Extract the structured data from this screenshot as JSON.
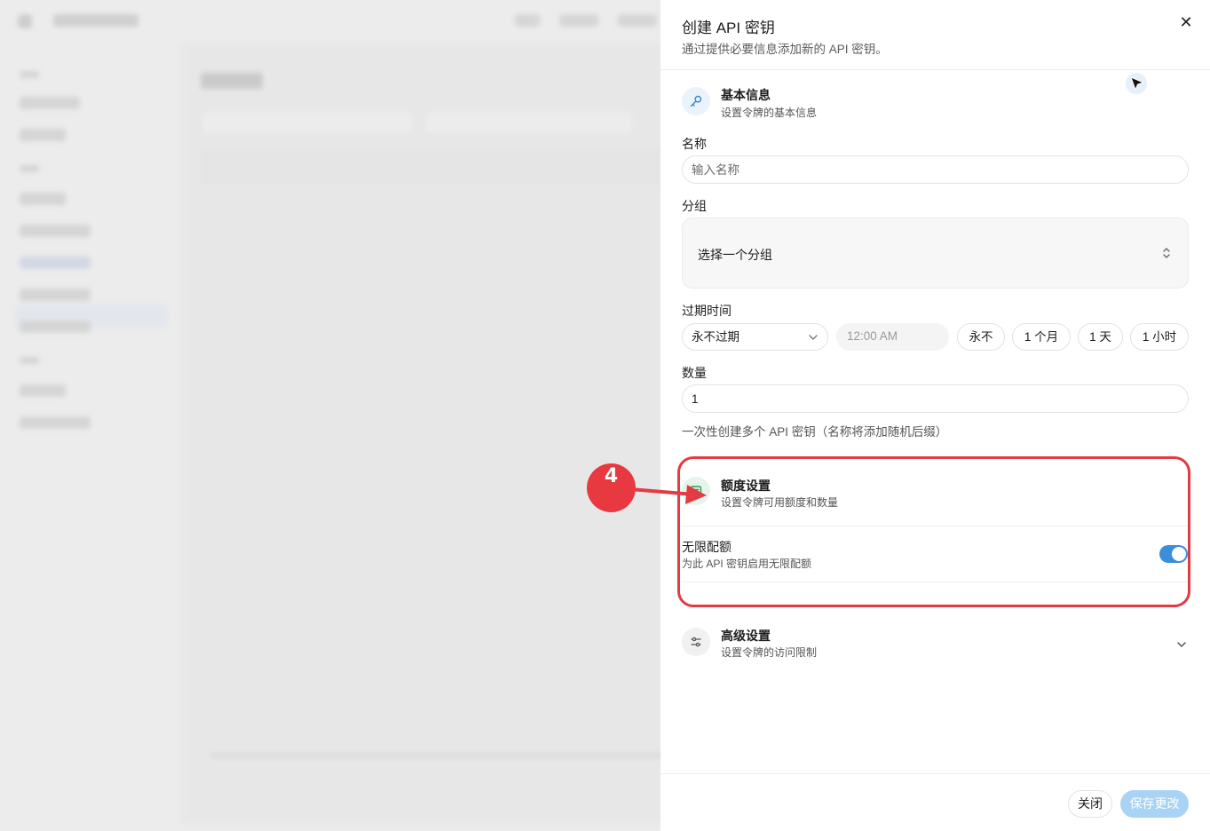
{
  "sheet": {
    "title": "创建 API 密钥",
    "description": "通过提供必要信息添加新的 API 密钥。",
    "close_icon": "close-icon"
  },
  "basic": {
    "title": "基本信息",
    "subtitle": "设置令牌的基本信息",
    "icon": "key-icon",
    "name_label": "名称",
    "name_placeholder": "输入名称",
    "group_label": "分组",
    "group_value": "选择一个分组",
    "group_icon": "chevron-up-down-icon",
    "expiry_label": "过期时间",
    "expiry_value": "永不过期",
    "expiry_time": "12:00 AM",
    "quick": [
      "永不",
      "1 个月",
      "1 天",
      "1 小时"
    ],
    "count_label": "数量",
    "count_value": "1",
    "count_help": "一次性创建多个 API 密钥（名称将添加随机后缀）"
  },
  "quota": {
    "title": "额度设置",
    "subtitle": "设置令牌可用额度和数量",
    "icon": "wallet-icon",
    "unlimited_label": "无限配额",
    "unlimited_desc": "为此 API 密钥启用无限配额",
    "unlimited_on": true
  },
  "advanced": {
    "title": "高级设置",
    "subtitle": "设置令牌的访问限制",
    "icon": "sliders-icon"
  },
  "footer": {
    "close_label": "关闭",
    "save_label": "保存更改"
  },
  "annotation": {
    "step": "4",
    "color": "#e23b44"
  },
  "colors": {
    "accent": "#3b8ed8",
    "save_disabled": "#a9d3f5"
  }
}
